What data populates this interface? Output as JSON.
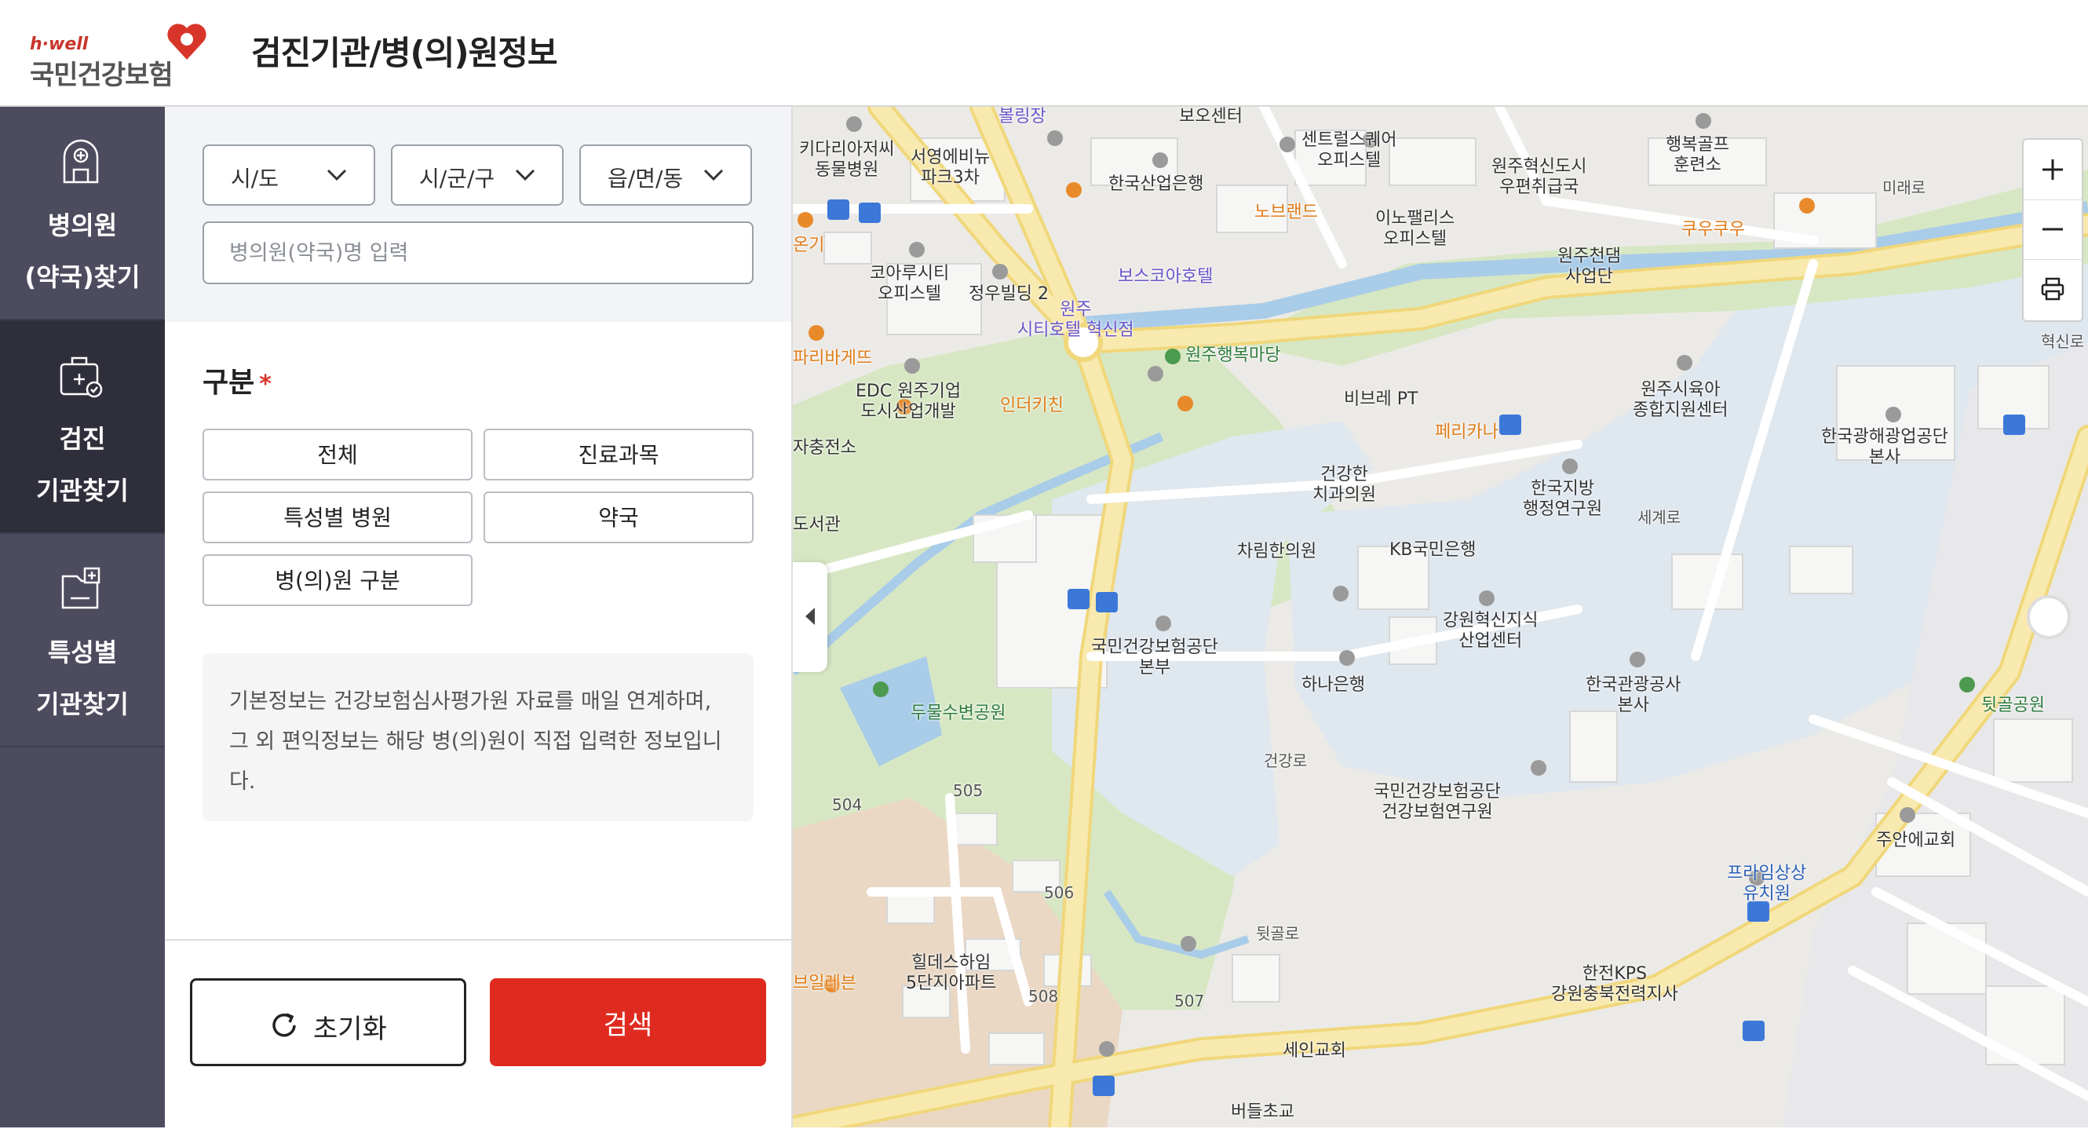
{
  "header": {
    "logo_small": "h·well",
    "logo_main": "국민건강보험",
    "title": "검진기관/병(의)원정보"
  },
  "nav": {
    "items": [
      {
        "label": "병의원\n(약국)찾기",
        "active": false,
        "icon": "hospital-icon"
      },
      {
        "label": "검진\n기관찾기",
        "active": true,
        "icon": "health-check-icon"
      },
      {
        "label": "특성별\n기관찾기",
        "active": false,
        "icon": "medical-folder-icon"
      }
    ]
  },
  "filters": {
    "sido": "시/도",
    "sigungu": "시/군/구",
    "eupmyeon": "읍/면/동",
    "name_placeholder": "병의원(약국)명 입력"
  },
  "category": {
    "title": "구분",
    "required_mark": "*",
    "buttons": [
      "전체",
      "진료과목",
      "특성별 병원",
      "약국",
      "병(의)원 구분"
    ]
  },
  "info": {
    "text": "기본정보는 건강보험심사평가원 자료를 매일 연계하며, 그 외 편익정보는 해당 병(의)원이 직접 입력한 정보입니다."
  },
  "actions": {
    "reset_label": "초기화",
    "search_label": "검색"
  },
  "map": {
    "zoom_in": "+",
    "zoom_out": "−",
    "pois": [
      {
        "label": "볼링장",
        "style": "purple"
      },
      {
        "label": "보오센터",
        "style": ""
      },
      {
        "label": "키다리아저씨\n동물병원",
        "style": ""
      },
      {
        "label": "서영에비뉴\n파크3차",
        "style": ""
      },
      {
        "label": "한국산업은행",
        "style": ""
      },
      {
        "label": "센트럴스퀘어\n오피스텔",
        "style": ""
      },
      {
        "label": "원주혁신도시\n우편취급국",
        "style": ""
      },
      {
        "label": "행복골프\n훈련소",
        "style": ""
      },
      {
        "label": "미래로",
        "style": "road"
      },
      {
        "label": "노브랜드",
        "style": "orange"
      },
      {
        "label": "이노팰리스\n오피스텔",
        "style": ""
      },
      {
        "label": "원주천댐\n사업단",
        "style": ""
      },
      {
        "label": "쿠우쿠우",
        "style": "orange"
      },
      {
        "label": "온기",
        "style": "orange"
      },
      {
        "label": "코아루시티\n오피스텔",
        "style": ""
      },
      {
        "label": "정우빌딩 2",
        "style": ""
      },
      {
        "label": "보스코아호텔",
        "style": "purple"
      },
      {
        "label": "원주\n시티호텔 혁신점",
        "style": "purple"
      },
      {
        "label": "파리바게뜨",
        "style": "orange"
      },
      {
        "label": "EDC 원주기업\n도시산업개발",
        "style": ""
      },
      {
        "label": "인더키친",
        "style": "orange"
      },
      {
        "label": "원주행복마당",
        "style": "green"
      },
      {
        "label": "비브레 PT",
        "style": ""
      },
      {
        "label": "원주시육아\n종합지원센터",
        "style": ""
      },
      {
        "label": "한국광해광업공단\n본사",
        "style": ""
      },
      {
        "label": "혁신로",
        "style": "road"
      },
      {
        "label": "자충전소",
        "style": ""
      },
      {
        "label": "페리카나",
        "style": "orange"
      },
      {
        "label": "건강한\n치과의원",
        "style": ""
      },
      {
        "label": "한국지방\n행정연구원",
        "style": ""
      },
      {
        "label": "도서관",
        "style": ""
      },
      {
        "label": "세계로",
        "style": "road"
      },
      {
        "label": "차림한의원",
        "style": ""
      },
      {
        "label": "KB국민은행",
        "style": ""
      },
      {
        "label": "국민건강보험공단\n본부",
        "style": ""
      },
      {
        "label": "강원혁신지식\n산업센터",
        "style": ""
      },
      {
        "label": "하나은행",
        "style": ""
      },
      {
        "label": "한국관광공사\n본사",
        "style": ""
      },
      {
        "label": "두물수변공원",
        "style": "green"
      },
      {
        "label": "뒷골공원",
        "style": "green"
      },
      {
        "label": "건강로",
        "style": "road"
      },
      {
        "label": "504",
        "style": "road"
      },
      {
        "label": "505",
        "style": "road"
      },
      {
        "label": "국민건강보험공단\n건강보험연구원",
        "style": ""
      },
      {
        "label": "주안에교회",
        "style": ""
      },
      {
        "label": "506",
        "style": "road"
      },
      {
        "label": "프라임상상\n유치원",
        "style": "blue"
      },
      {
        "label": "힐데스하임\n5단지아파트",
        "style": ""
      },
      {
        "label": "뒷골로",
        "style": "road"
      },
      {
        "label": "브일레븐",
        "style": "orange"
      },
      {
        "label": "508",
        "style": "road"
      },
      {
        "label": "507",
        "style": "road"
      },
      {
        "label": "한전KPS\n강원충북전력지사",
        "style": ""
      },
      {
        "label": "세인교회",
        "style": ""
      },
      {
        "label": "버들초교",
        "style": ""
      }
    ]
  },
  "colors": {
    "accent": "#df2b1f",
    "nav_bg": "#4d4c5f",
    "nav_active": "#2f2f3c",
    "road_yellow": "#f7e49a",
    "water": "#a9cce8",
    "park": "#dbe8c8"
  }
}
